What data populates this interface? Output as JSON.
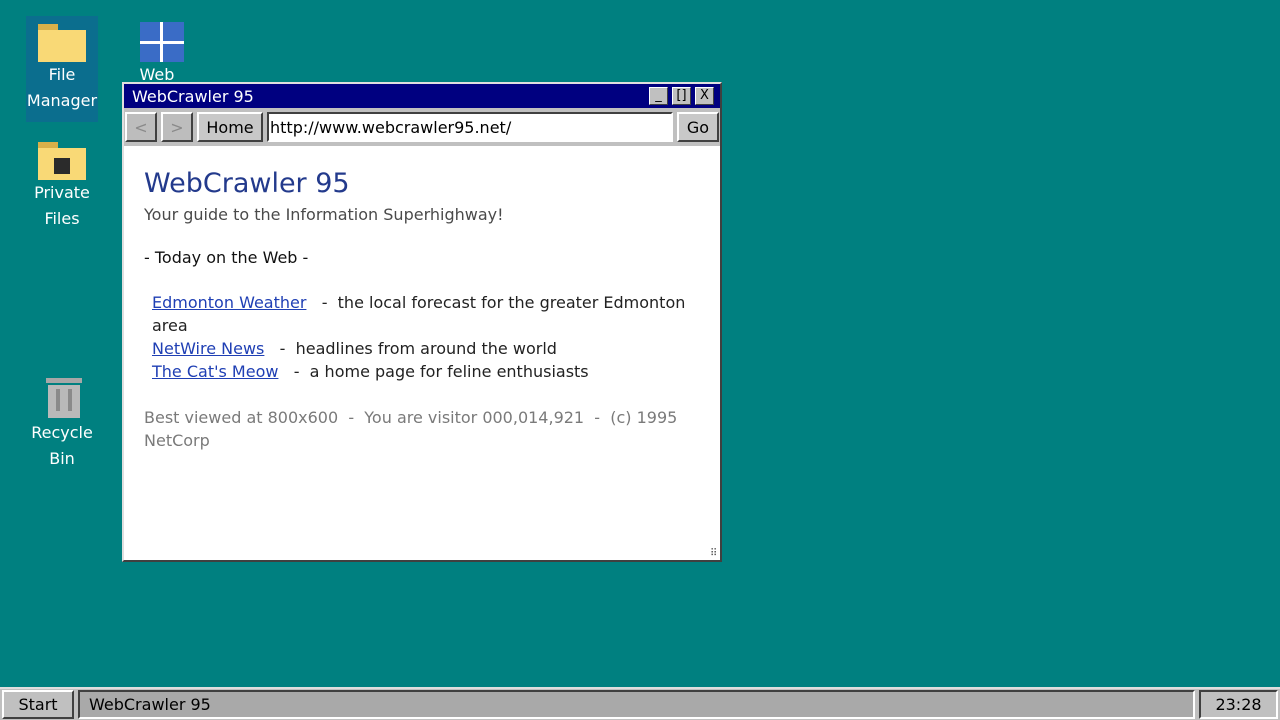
{
  "desktop": {
    "icons": [
      {
        "label_line1": "File",
        "label_line2": "Manager"
      },
      {
        "label_line1": "Web",
        "label_line2": ""
      },
      {
        "label_line1": "Private",
        "label_line2": "Files"
      },
      {
        "label_line1": "Recycle",
        "label_line2": "Bin"
      }
    ]
  },
  "window": {
    "title": "WebCrawler 95",
    "controls": {
      "minimize": "_",
      "maximize": "[]",
      "close": "X"
    },
    "toolbar": {
      "back_label": "<",
      "forward_label": ">",
      "home_label": "Home",
      "url": "http://www.webcrawler95.net/",
      "go_label": "Go"
    },
    "page": {
      "title": "WebCrawler 95",
      "tagline": "Your guide to the Information Superhighway!",
      "section_heading": "- Today on the Web -",
      "links": [
        {
          "text": "Edmonton Weather",
          "desc": "the local forecast for the greater Edmonton area"
        },
        {
          "text": "NetWire News",
          "desc": "headlines from around the world"
        },
        {
          "text": "The Cat's Meow",
          "desc": "a home page for feline enthusiasts"
        }
      ],
      "footer": "Best viewed at 800x600  -  You are visitor 000,014,921  -  (c) 1995 NetCorp"
    }
  },
  "taskbar": {
    "start_label": "Start",
    "task_label": "WebCrawler 95",
    "clock": "23:28"
  },
  "colors": {
    "desktop": "#008080",
    "titlebar": "#000080",
    "link": "#1f3fb4",
    "page_title": "#233a8c"
  }
}
